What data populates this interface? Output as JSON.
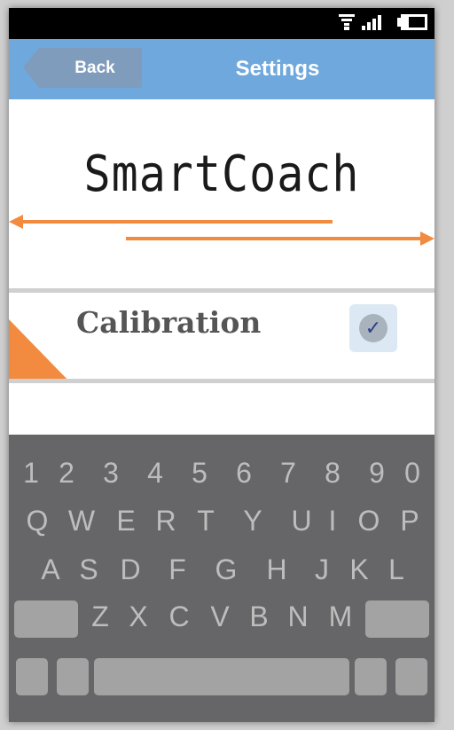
{
  "header": {
    "back_label": "Back",
    "title": "Settings"
  },
  "app": {
    "title": "SmartCoach"
  },
  "settings": {
    "calibration_label": "Calibration",
    "calibration_checked": true,
    "check_symbol": "✓"
  },
  "status_icons": [
    "wifi-icon",
    "signal-icon",
    "battery-icon"
  ],
  "colors": {
    "header": "#6fa8dc",
    "back_button": "#7f9cbd",
    "accent": "#f28a3f",
    "keyboard": "#666668",
    "key_block": "#a3a3a3"
  },
  "keyboard": {
    "row_numbers": [
      "1",
      "2",
      "3",
      "4",
      "5",
      "6",
      "7",
      "8",
      "9",
      "0"
    ],
    "row_1": [
      "Q",
      "W",
      "E",
      "R",
      "T",
      "Y",
      "U",
      "I",
      "O",
      "P"
    ],
    "row_2": [
      "A",
      "S",
      "D",
      "F",
      "G",
      "H",
      "J",
      "K",
      "L"
    ],
    "row_3": [
      "Z",
      "X",
      "C",
      "V",
      "B",
      "N",
      "M"
    ]
  }
}
